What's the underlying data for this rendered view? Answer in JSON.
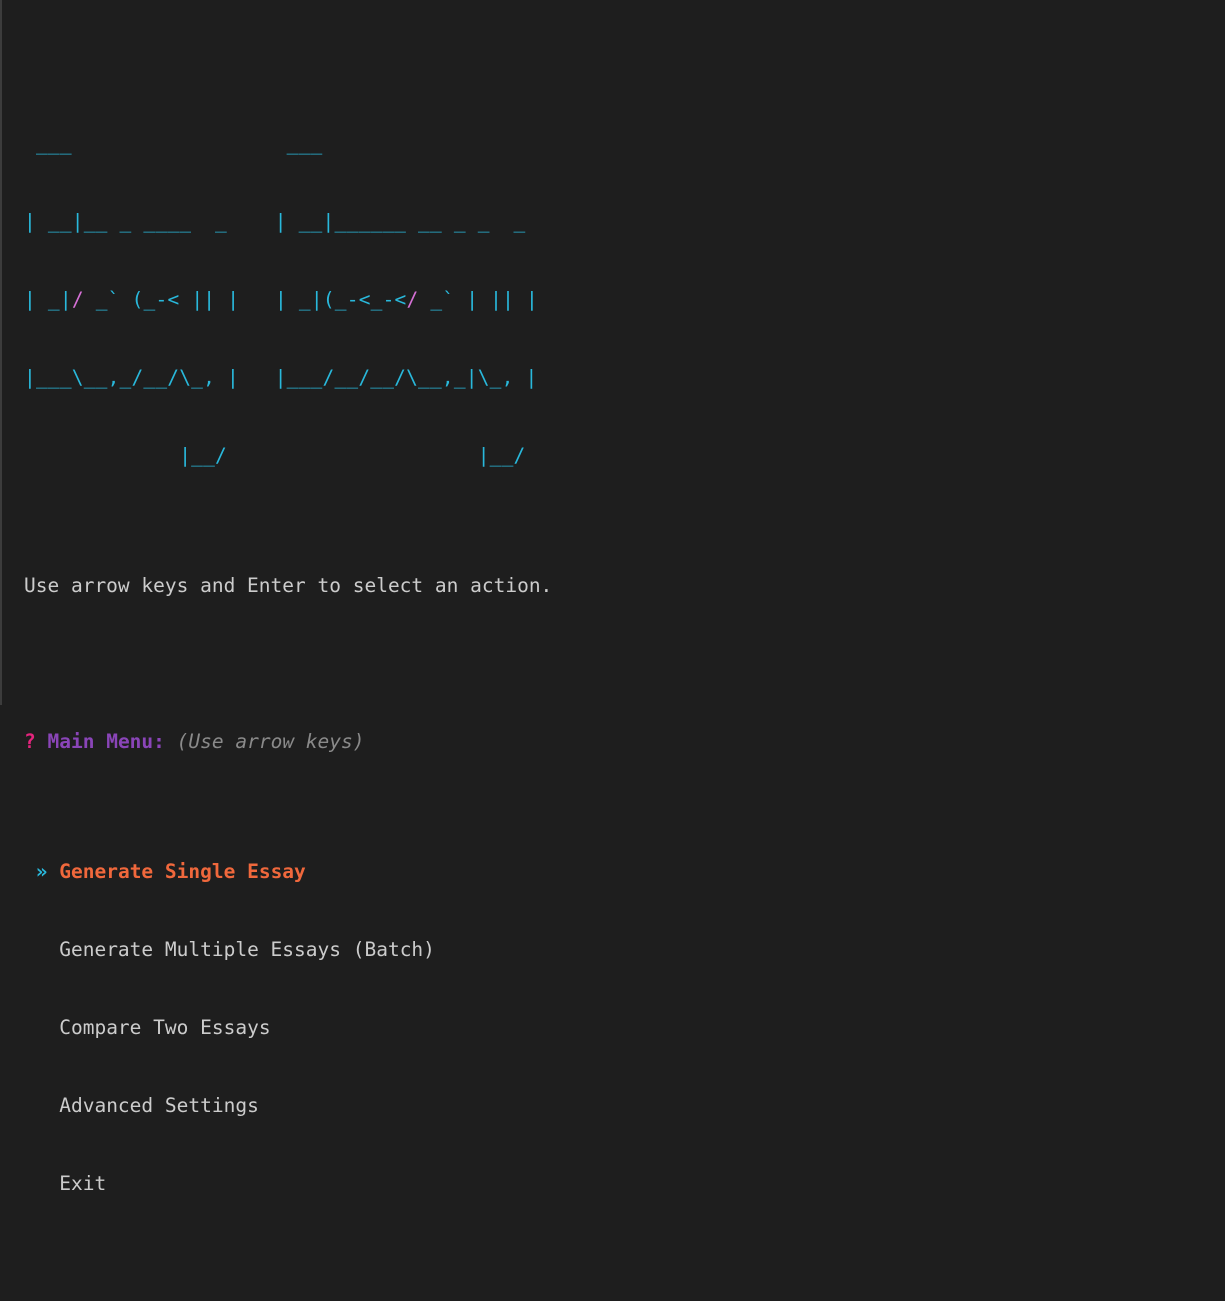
{
  "banner": {
    "lines": [
      " ___                  ___",
      "| __|__ _ ____  _    | __|______ __ _ _  _",
      "| _|/ _` (_-< || |   | _|(_-<_-</ _` | || |",
      "|___\\__,_/__/\\_, |   |___/__/__/\\__,_|\\_, |",
      "             |__/                     |__/"
    ]
  },
  "instructions": "Use arrow keys and Enter to select an action.",
  "prompt": {
    "mark": "?",
    "label": "Main Menu:",
    "hint": "(Use arrow keys)"
  },
  "menu": {
    "pointer": "»",
    "selected_index": 0,
    "items": [
      {
        "label": "Generate Single Essay"
      },
      {
        "label": "Generate Multiple Essays (Batch)"
      },
      {
        "label": "Compare Two Essays"
      },
      {
        "label": "Advanced Settings"
      },
      {
        "label": "Exit"
      }
    ]
  },
  "colors": {
    "background": "#1e1e1e",
    "banner": "#29b8db",
    "banner_accent": "#d670d6",
    "text": "#cccccc",
    "question_mark": "#e4247d",
    "prompt_label": "#8a45b8",
    "hint": "#8a8a8a",
    "selected": "#f0683c"
  }
}
